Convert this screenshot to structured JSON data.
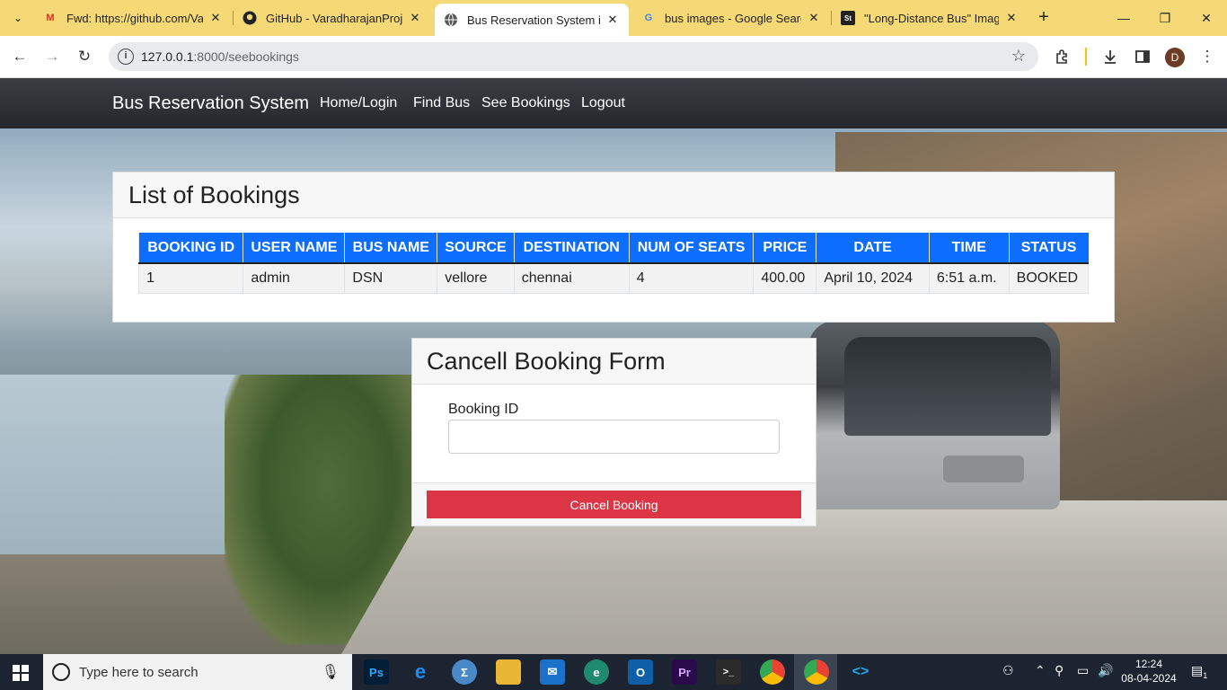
{
  "browser": {
    "tabs": [
      {
        "title": "Fwd: https://github.com/Var",
        "icon": "gmail-icon"
      },
      {
        "title": "GitHub - VaradharajanProjec",
        "icon": "github-icon"
      },
      {
        "title": "Bus Reservation System in D",
        "icon": "globe-icon",
        "active": true
      },
      {
        "title": "bus images - Google Search",
        "icon": "google-icon"
      },
      {
        "title": "\"Long-Distance Bus\" Images",
        "icon": "st-icon"
      }
    ],
    "url_host": "127.0.0.1",
    "url_rest": ":8000/seebookings",
    "profile_initial": "D"
  },
  "nav": {
    "brand": "Bus Reservation System",
    "links": [
      "Home/Login",
      "Find Bus",
      "See Bookings",
      "Logout"
    ]
  },
  "bookings": {
    "title": "List of Bookings",
    "columns": [
      "BOOKING ID",
      "USER NAME",
      "BUS NAME",
      "SOURCE",
      "DESTINATION",
      "NUM OF SEATS",
      "PRICE",
      "DATE",
      "TIME",
      "STATUS"
    ],
    "rows": [
      [
        "1",
        "admin",
        "DSN",
        "vellore",
        "chennai",
        "4",
        "400.00",
        "April 10, 2024",
        "6:51 a.m.",
        "BOOKED"
      ]
    ]
  },
  "cancel_form": {
    "title": "Cancell Booking Form",
    "field_label": "Booking ID",
    "field_value": "",
    "button_label": "Cancel Booking"
  },
  "taskbar": {
    "search_placeholder": "Type here to search",
    "time": "12:24",
    "date": "08-04-2024",
    "notification_count": "1",
    "apps": [
      {
        "label": "Ps",
        "color": "#001e36"
      },
      {
        "label": "e",
        "color": "#1f6feb"
      },
      {
        "label": "Σ",
        "color": "#4a89c8"
      },
      {
        "label": "",
        "color": "#e8b632"
      },
      {
        "label": "✉",
        "color": "#1a73c8"
      },
      {
        "label": "e",
        "color": "#1f8a70"
      },
      {
        "label": "O",
        "color": "#0f5ea8"
      },
      {
        "label": "Pr",
        "color": "#2a0a4a"
      },
      {
        "label": ">_",
        "color": "#2b2b2b"
      },
      {
        "label": "",
        "color": "#34a853"
      },
      {
        "label": "",
        "color": "#ea4335"
      },
      {
        "label": "<>",
        "color": "#0f6cbd"
      }
    ]
  }
}
